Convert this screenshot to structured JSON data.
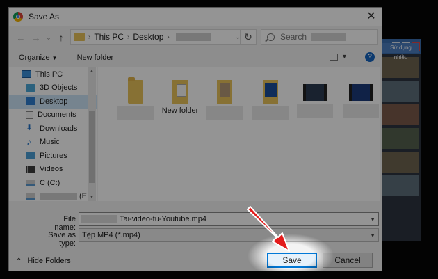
{
  "dialog": {
    "title": "Save As",
    "close_glyph": "✕"
  },
  "address": {
    "back_glyph": "←",
    "forward_glyph": "→",
    "recent_glyph": "⌄",
    "up_glyph": "↑",
    "crumbs": [
      "This PC",
      "Desktop"
    ],
    "refresh_glyph": "↻",
    "search_placeholder": "Search"
  },
  "toolbar": {
    "organize_label": "Organize",
    "new_folder_label": "New folder",
    "help_glyph": "?"
  },
  "nav": {
    "items": [
      {
        "label": "This PC",
        "icon": "pc-icon"
      },
      {
        "label": "3D Objects",
        "icon": "3d-objects-icon"
      },
      {
        "label": "Desktop",
        "icon": "desktop-icon",
        "selected": true
      },
      {
        "label": "Documents",
        "icon": "documents-icon"
      },
      {
        "label": "Downloads",
        "icon": "downloads-icon"
      },
      {
        "label": "Music",
        "icon": "music-icon"
      },
      {
        "label": "Pictures",
        "icon": "pictures-icon"
      },
      {
        "label": "Videos",
        "icon": "videos-icon"
      },
      {
        "label": "C (C:)",
        "icon": "drive-icon"
      },
      {
        "label": "(E:",
        "icon": "drive-icon"
      }
    ]
  },
  "files": {
    "items": [
      {
        "label": "",
        "icon": "folder-icon"
      },
      {
        "label": "New folder",
        "icon": "folder-icon"
      },
      {
        "label": "",
        "icon": "folder-icon"
      },
      {
        "label": "",
        "icon": "folder-icon"
      },
      {
        "label": "",
        "icon": "video-file-icon"
      },
      {
        "label": "",
        "icon": "video-file-icon"
      }
    ]
  },
  "form": {
    "file_name_label": "File name:",
    "file_name_value": "Tai-video-tu-Youtube.mp4",
    "save_as_type_label": "Save as type:",
    "save_as_type_value": "Tệp MP4 (*.mp4)"
  },
  "footer": {
    "hide_folders_label": "Hide Folders",
    "save_label": "Save",
    "cancel_label": "Cancel"
  },
  "background_window": {
    "button_text": "Sử dụng nhiều"
  }
}
